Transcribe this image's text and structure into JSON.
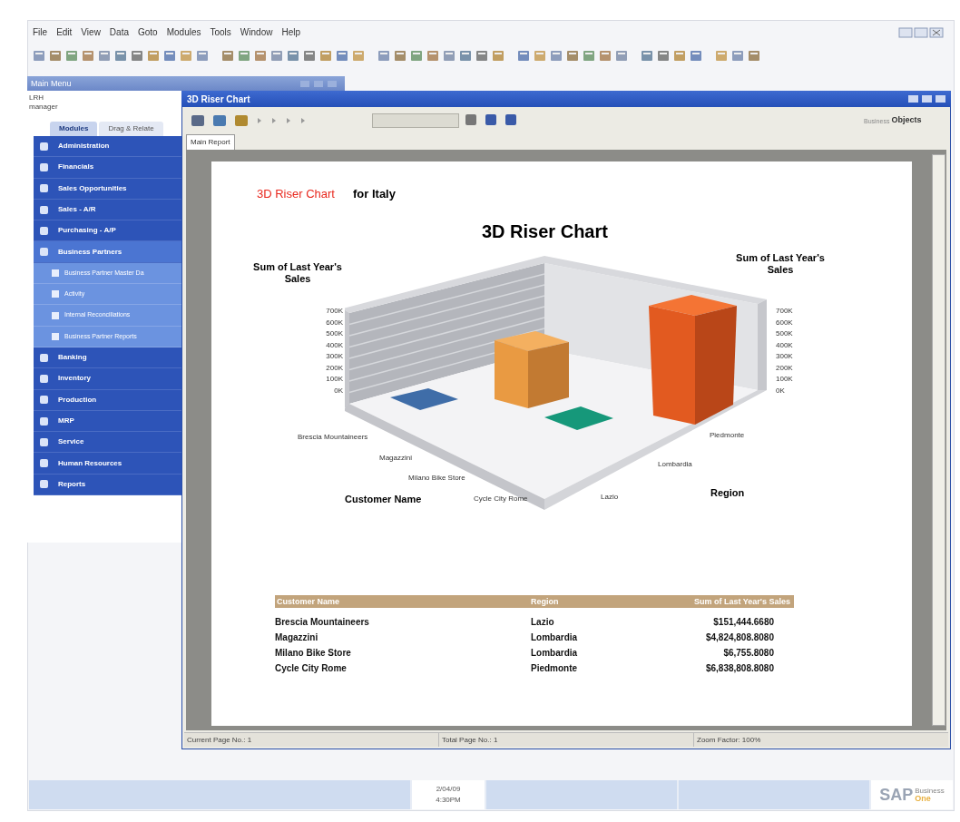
{
  "menu_bar": [
    "File",
    "Edit",
    "View",
    "Data",
    "Goto",
    "Modules",
    "Tools",
    "Window",
    "Help"
  ],
  "main_menu": {
    "title": "Main Menu",
    "company": "LRH",
    "user": "manager",
    "tabs": [
      {
        "label": "Modules",
        "selected": true
      },
      {
        "label": "Drag & Relate",
        "selected": false
      }
    ],
    "modules": [
      {
        "label": "Administration",
        "selected": false
      },
      {
        "label": "Financials",
        "selected": false
      },
      {
        "label": "Sales Opportunities",
        "selected": false
      },
      {
        "label": "Sales - A/R",
        "selected": false
      },
      {
        "label": "Purchasing - A/P",
        "selected": false
      },
      {
        "label": "Business Partners",
        "selected": true,
        "children": [
          {
            "label": "Business Partner Master Da"
          },
          {
            "label": "Activity"
          },
          {
            "label": "Internal Reconciliations"
          },
          {
            "label": "Business Partner Reports"
          }
        ]
      },
      {
        "label": "Banking",
        "selected": false
      },
      {
        "label": "Inventory",
        "selected": false
      },
      {
        "label": "Production",
        "selected": false
      },
      {
        "label": "MRP",
        "selected": false
      },
      {
        "label": "Service",
        "selected": false
      },
      {
        "label": "Human Resources",
        "selected": false
      },
      {
        "label": "Reports",
        "selected": false
      }
    ]
  },
  "report_window": {
    "title": "3D Riser Chart",
    "branding": {
      "small": "Business",
      "large": "Objects"
    },
    "tabs": [
      {
        "label": "Main Report",
        "selected": true
      }
    ],
    "report": {
      "heading_red": "3D Riser Chart",
      "heading_rest": "for Italy",
      "chart_title": "3D Riser Chart",
      "left_axis_title": "Sum of Last Year's Sales",
      "right_axis_title": "Sum of Last Year's Sales",
      "left_ticks": [
        "700K",
        "600K",
        "500K",
        "400K",
        "300K",
        "200K",
        "100K",
        "0K"
      ],
      "right_ticks": [
        "700K",
        "600K",
        "500K",
        "400K",
        "300K",
        "200K",
        "100K",
        "0K"
      ],
      "customers": [
        "Brescia Mountaineers",
        "Magazzini",
        "Milano Bike Store",
        "Cycle City Rome"
      ],
      "customer_axis_title": "Customer Name",
      "regions": [
        "Piedmonte",
        "Lombardia",
        "Lazio"
      ],
      "region_axis_title": "Region",
      "table": {
        "columns": [
          "Customer Name",
          "Region",
          "Sum of Last Year's Sales"
        ],
        "rows": [
          [
            "Brescia Mountaineers",
            "Lazio",
            "$151,444.6680"
          ],
          [
            "Magazzini",
            "Lombardia",
            "$4,824,808.8080"
          ],
          [
            "Milano Bike Store",
            "Lombardia",
            "$6,755.8080"
          ],
          [
            "Cycle City Rome",
            "Piedmonte",
            "$6,838,808.8080"
          ]
        ]
      }
    },
    "status_bar": [
      "Current Page No.: 1",
      "Total Page No.: 1",
      "Zoom Factor: 100%"
    ]
  },
  "taskbar": {
    "date": "2/04/09",
    "time": "4:30PM"
  },
  "logo": {
    "mark": "SAP",
    "line1": "Business",
    "line2": "One"
  }
}
